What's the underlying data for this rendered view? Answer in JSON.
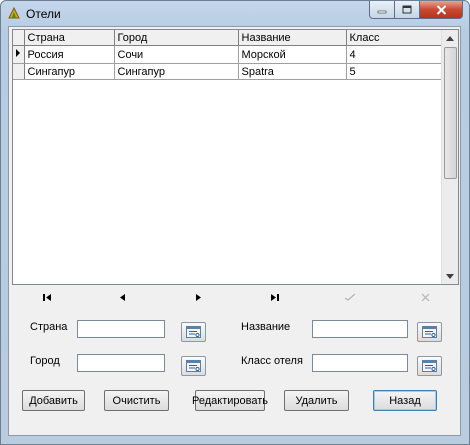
{
  "window": {
    "title": "Отели",
    "app_icon": "app-icon",
    "controls": [
      "minimize-icon",
      "maximize-icon",
      "close-icon"
    ]
  },
  "grid": {
    "columns": [
      "Страна",
      "Город",
      "Название",
      "Класс"
    ],
    "rows": [
      {
        "country": "Россия",
        "city": "Сочи",
        "name": "Морской",
        "class": "4",
        "current": true
      },
      {
        "country": "Сингапур",
        "city": "Сингапур",
        "name": "Spatra",
        "class": "5",
        "current": false
      }
    ]
  },
  "navigator": [
    "first-record-icon",
    "prior-record-icon",
    "next-record-icon",
    "last-record-icon",
    "post-icon",
    "cancel-icon"
  ],
  "form": {
    "country_label": "Страна",
    "city_label": "Город",
    "name_label": "Название",
    "class_label": "Класс отеля",
    "country_value": "",
    "city_value": "",
    "name_value": "",
    "class_value": ""
  },
  "buttons": {
    "add": "Добавить",
    "clear": "Очистить",
    "edit": "Редактировать",
    "delete": "Удалить",
    "back": "Назад"
  },
  "colors": {
    "titlebar": "#c4d6ea",
    "close_button": "#c74b34",
    "default_button_border": "#3c7fb1"
  }
}
